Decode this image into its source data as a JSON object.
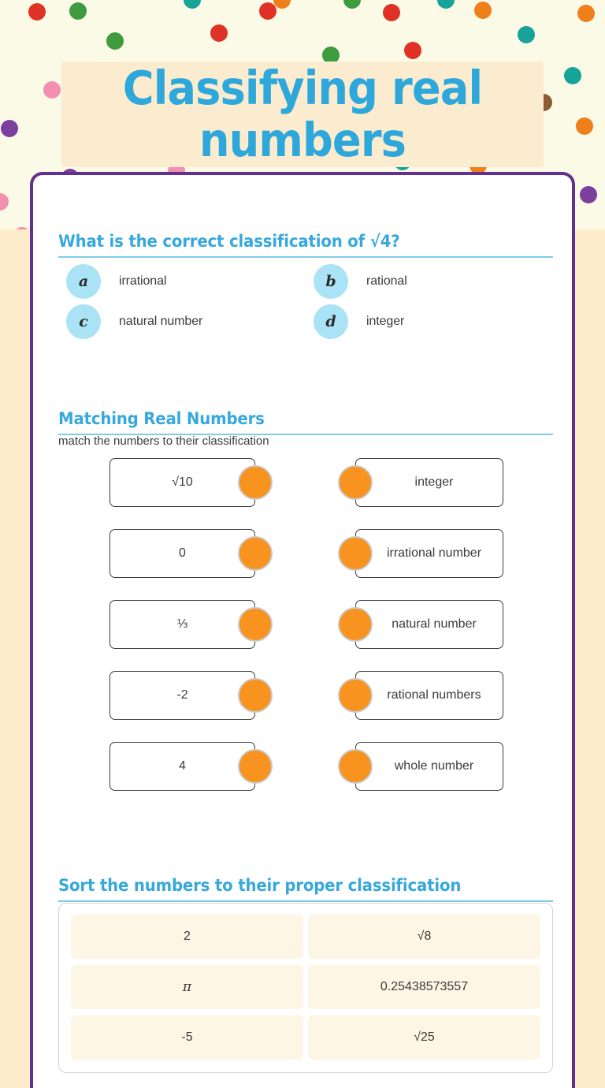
{
  "title": "Classifying real numbers",
  "colors": {
    "heading_blue": "#37a8db",
    "title_blue": "#2ea7db",
    "card_border_purple": "#63308e",
    "bubble_blue": "#a9e3f5",
    "match_dot_orange": "#f7931e",
    "banner_cream": "#fbeccf",
    "page_peach": "#fcecca",
    "dots_bg": "#fbfae7",
    "tile_cream": "#fdf6e4"
  },
  "multiple_choice": {
    "heading": "What is the correct classification of √4?",
    "options": [
      {
        "letter": "a",
        "label": "irrational"
      },
      {
        "letter": "b",
        "label": "rational"
      },
      {
        "letter": "c",
        "label": "natural number"
      },
      {
        "letter": "d",
        "label": "integer"
      }
    ]
  },
  "matching": {
    "heading": "Matching Real Numbers",
    "instruction": "match the numbers to their classification",
    "left_items": [
      "√10",
      "0",
      "⅓",
      "-2",
      "4"
    ],
    "right_items": [
      "integer",
      "irrational number",
      "natural number",
      "rational numbers",
      "whole number"
    ]
  },
  "sorting": {
    "heading": "Sort the numbers to their proper classification",
    "rows": [
      [
        "2",
        "√8"
      ],
      [
        "π",
        "0.25438573557"
      ],
      [
        "-5",
        "√25"
      ]
    ]
  },
  "decor": {
    "dot_colors": [
      "#e03127",
      "#8e5a33",
      "#7d3f9e",
      "#17a398",
      "#3e9b3e",
      "#f0c419",
      "#f48fb1",
      "#ef7f1a"
    ]
  }
}
